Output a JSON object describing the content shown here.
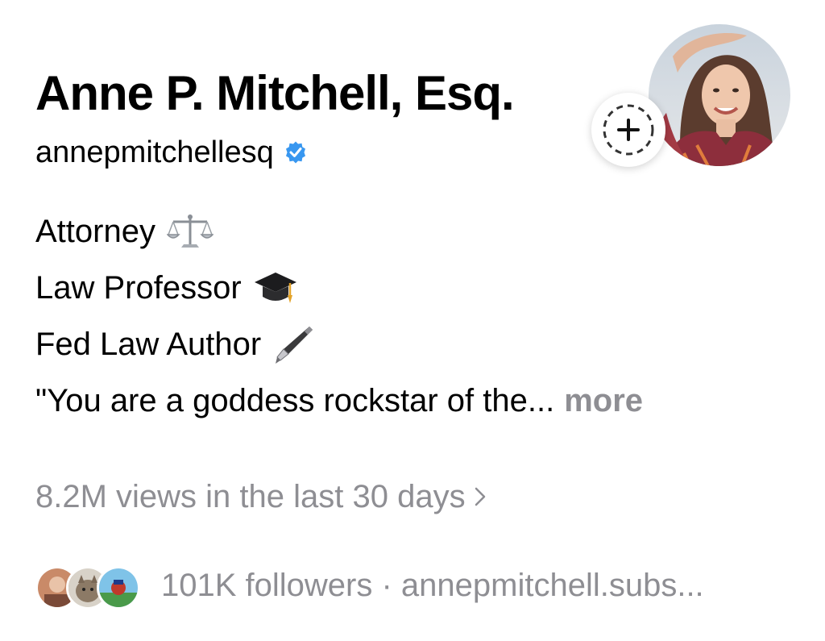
{
  "profile": {
    "name": "Anne P. Mitchell, Esq.",
    "handle": "annepmitchellesq",
    "verified": true,
    "verified_color": "#3897f0",
    "avatar_icon": "profile-photo",
    "add_story_icon": "plus-icon"
  },
  "bio": {
    "lines": [
      {
        "text": "Attorney",
        "emoji": "balance-scale-icon"
      },
      {
        "text": "Law Professor",
        "emoji": "graduation-cap-icon"
      },
      {
        "text": "Fed Law Author",
        "emoji": "fountain-pen-icon"
      },
      {
        "text": "\"You are a goddess rockstar of the..."
      }
    ],
    "more_label": "more"
  },
  "stats": {
    "views": "8.2M views in the last 30 days",
    "followers": "101K followers · annepmitchell.subs..."
  },
  "colors": {
    "secondary_text": "#8e8e93",
    "primary_text": "#000000"
  }
}
